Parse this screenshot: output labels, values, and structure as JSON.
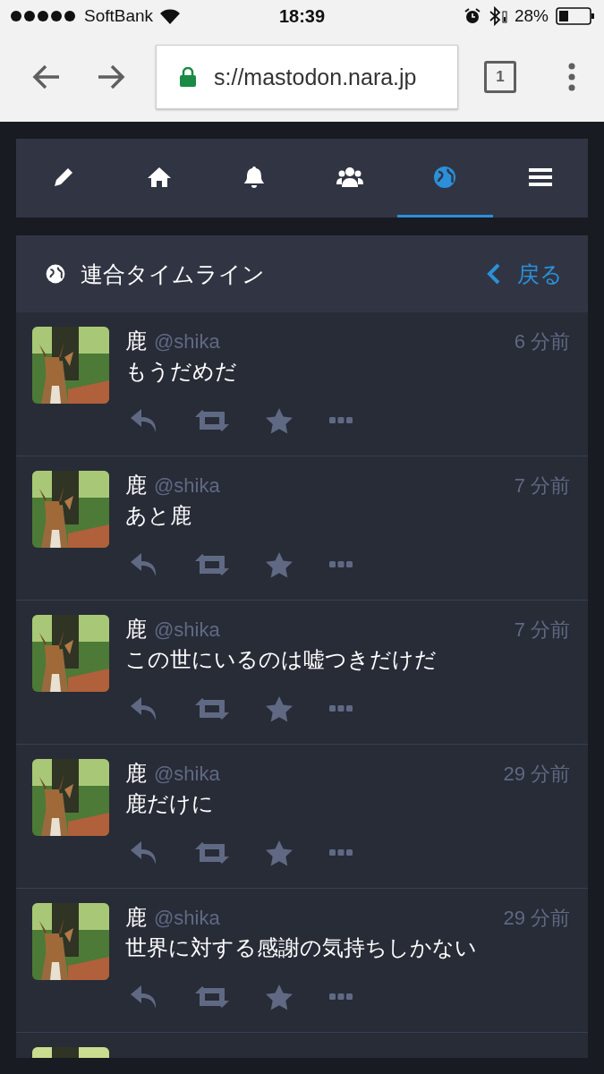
{
  "status_bar": {
    "carrier": "SoftBank",
    "time": "18:39",
    "battery": "28%"
  },
  "browser": {
    "url": "s://mastodon.nara.jp",
    "tab_count": "1"
  },
  "nav_tabs": [
    {
      "kind": "compose",
      "selected": false
    },
    {
      "kind": "home",
      "selected": false
    },
    {
      "kind": "notifications",
      "selected": false
    },
    {
      "kind": "local",
      "selected": false
    },
    {
      "kind": "federated",
      "selected": true
    },
    {
      "kind": "menu",
      "selected": false
    }
  ],
  "column": {
    "title": "連合タイムライン",
    "back": "戻る"
  },
  "statuses": [
    {
      "name": "鹿",
      "handle": "@shika",
      "time": "6 分前",
      "content": "もうだめだ"
    },
    {
      "name": "鹿",
      "handle": "@shika",
      "time": "7 分前",
      "content": "あと鹿"
    },
    {
      "name": "鹿",
      "handle": "@shika",
      "time": "7 分前",
      "content": "この世にいるのは嘘つきだけだ"
    },
    {
      "name": "鹿",
      "handle": "@shika",
      "time": "29 分前",
      "content": "鹿だけに"
    },
    {
      "name": "鹿",
      "handle": "@shika",
      "time": "29 分前",
      "content": "世界に対する感謝の気持ちしかない"
    }
  ]
}
